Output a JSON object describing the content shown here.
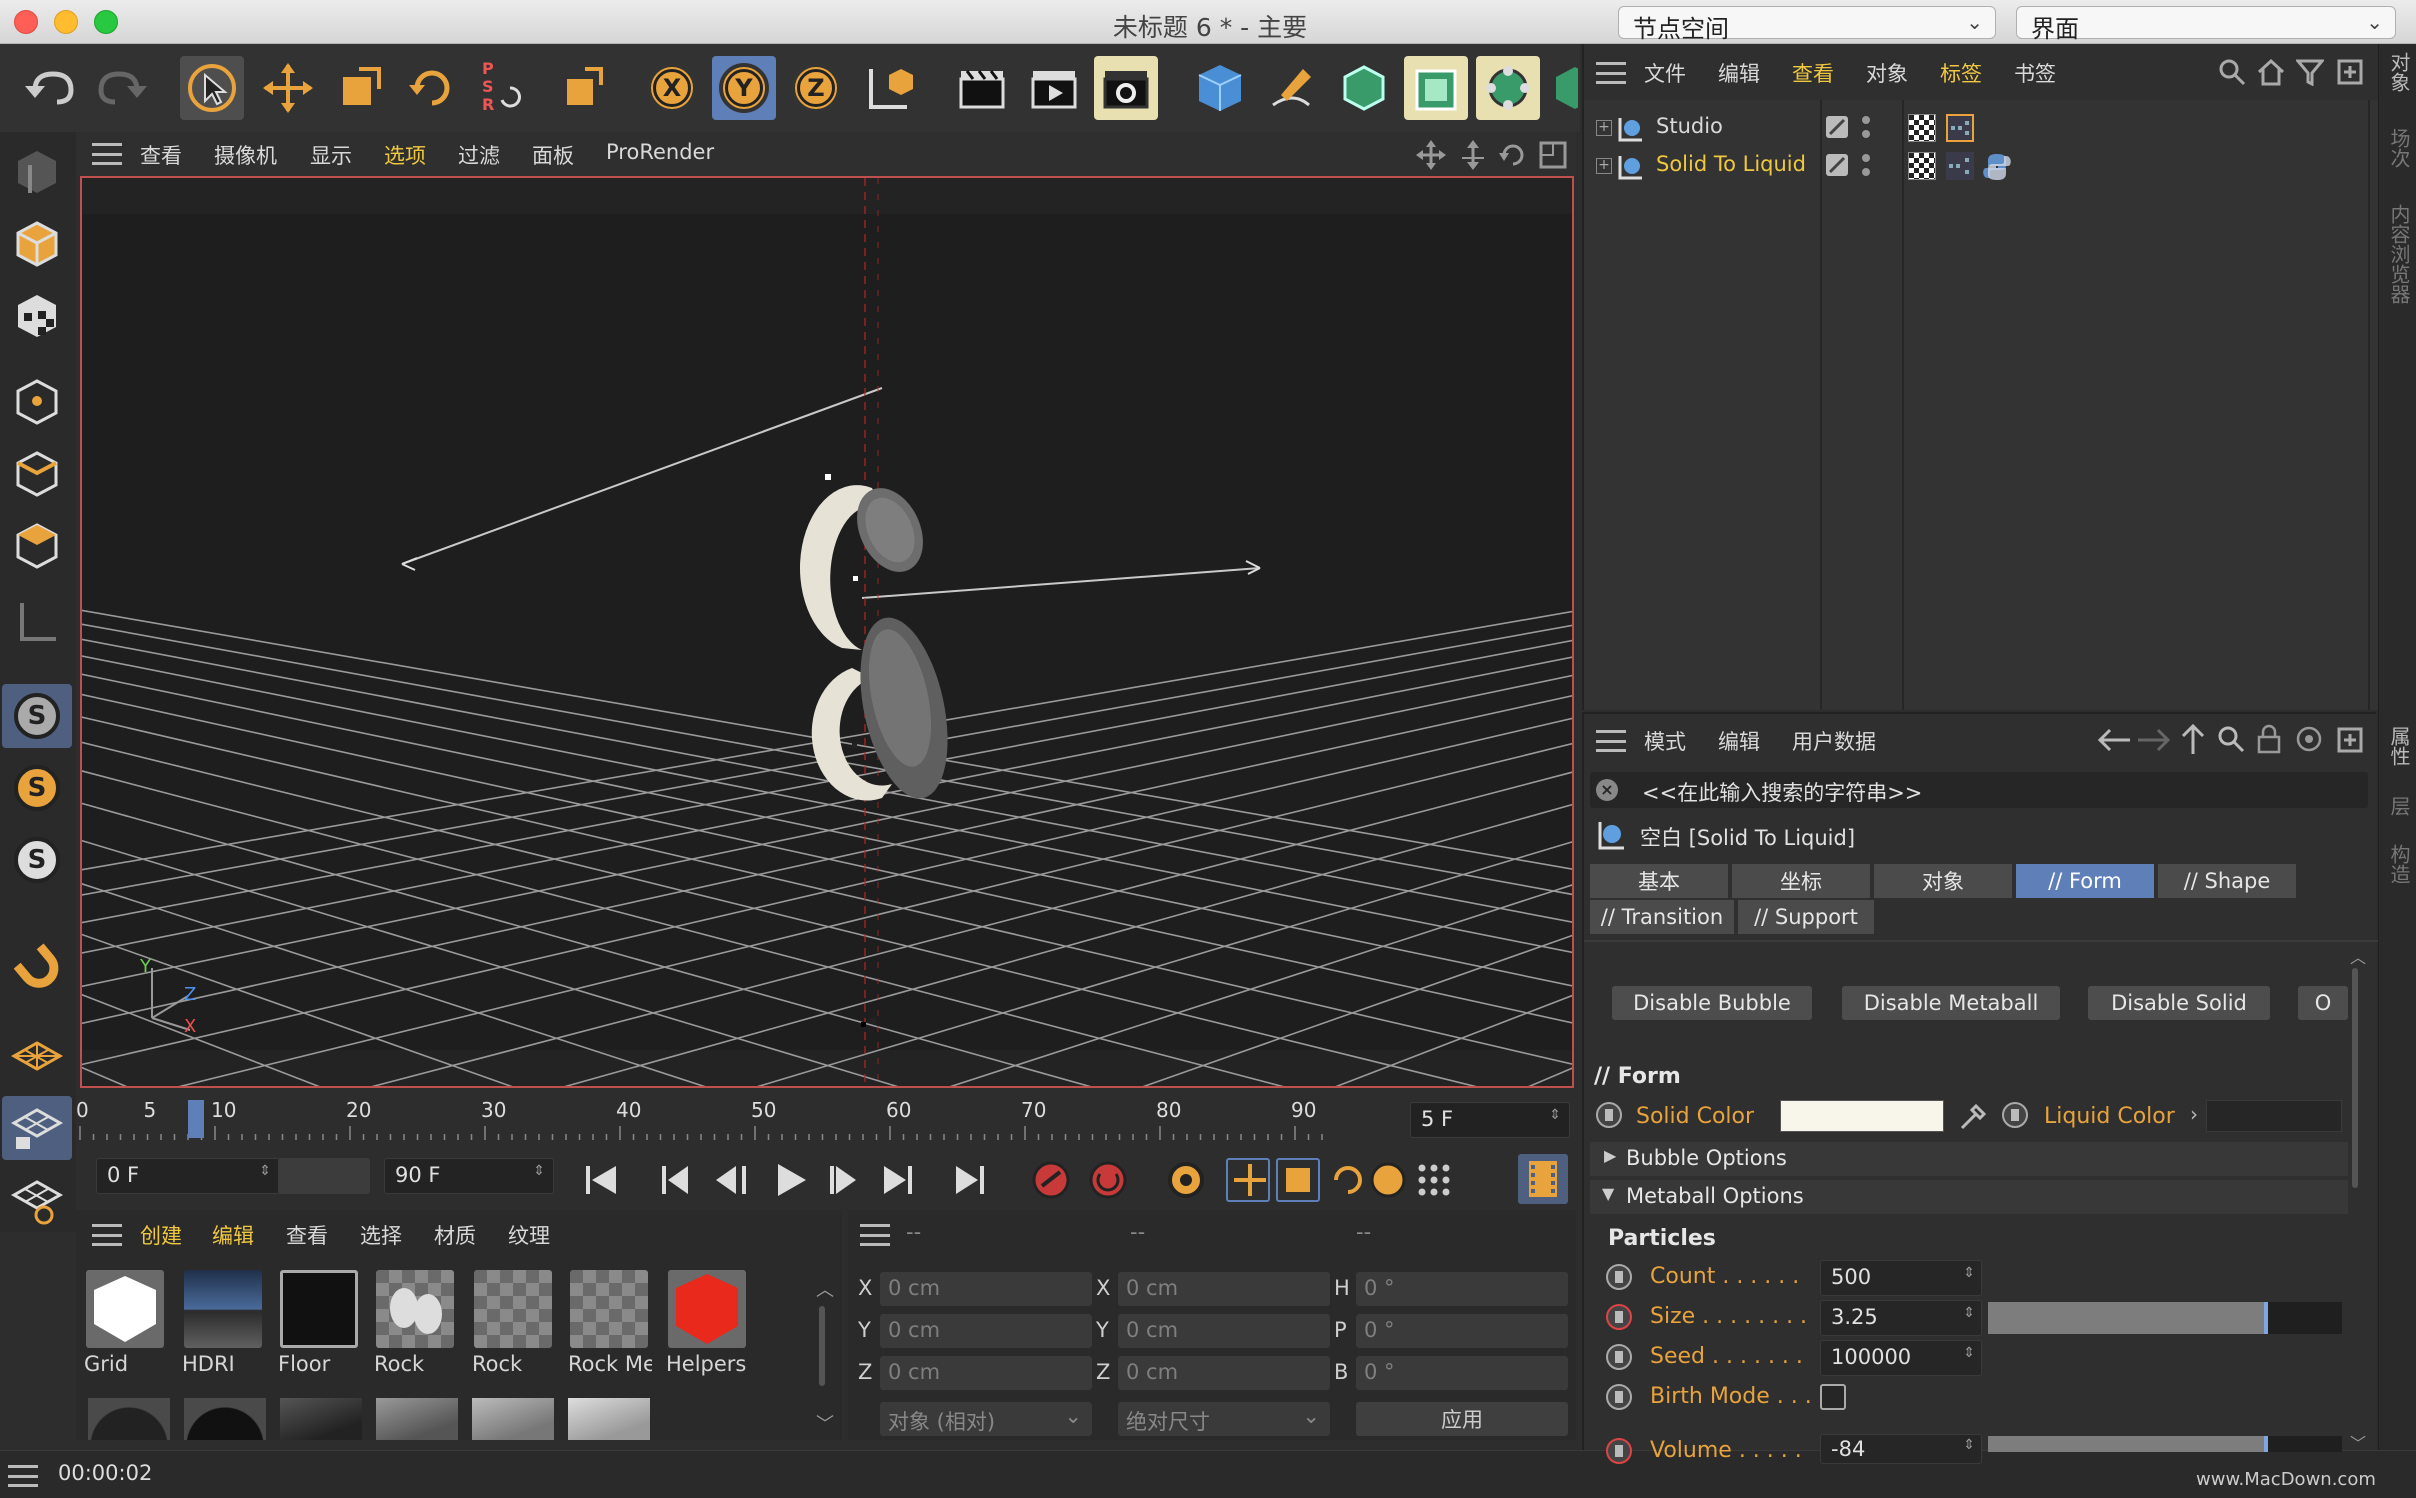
{
  "window": {
    "title": "未标题 6 * - 主要",
    "node_space": "节点空间",
    "layout": "界面"
  },
  "viewport_menu": {
    "items": [
      "查看",
      "摄像机",
      "显示",
      "选项",
      "过滤",
      "面板",
      "ProRender"
    ],
    "highlight_index": 3
  },
  "toolbar": {
    "psr_label": "P S R",
    "axis_x": "X",
    "axis_y": "Y",
    "axis_z": "Z"
  },
  "viewport_axis": {
    "y": "Y",
    "z": "Z",
    "x": "X"
  },
  "object_manager": {
    "menu": [
      "文件",
      "编辑",
      "查看",
      "对象",
      "标签",
      "书签"
    ],
    "objects": [
      {
        "name": "Studio",
        "selected": false
      },
      {
        "name": "Solid To Liquid",
        "selected": true
      }
    ]
  },
  "right_vtabs": {
    "top": [
      "对象",
      "场次",
      "内容浏览器"
    ],
    "bottom": [
      "属性",
      "层",
      "构造"
    ]
  },
  "attributes": {
    "menu": [
      "模式",
      "编辑",
      "用户数据"
    ],
    "search_placeholder": "<<在此输入搜索的字符串>>",
    "object_title": "空白 [Solid To Liquid]",
    "tabs_row1": [
      "基本",
      "坐标",
      "对象",
      "// Form",
      "// Shape"
    ],
    "tabs_row2": [
      "// Transition",
      "// Support"
    ],
    "active_tab": "// Form",
    "buttons": [
      "Disable Bubble",
      "Disable Metaball",
      "Disable Solid",
      "O"
    ],
    "section_title": "// Form",
    "solid_color_label": "Solid Color",
    "liquid_color_label": "Liquid Color",
    "solid_color": "#f8f6ea",
    "bubble_options": "Bubble Options",
    "metaball_options": "Metaball Options",
    "particles_heading": "Particles",
    "count_label": "Count . . . . . .",
    "count_value": "500",
    "size_label": "Size . . . . . . . .",
    "size_value": "3.25",
    "size_slider": 0.79,
    "seed_label": "Seed . . . . . . .",
    "seed_value": "100000",
    "birth_label": "Birth Mode . . .",
    "volume_label": "Volume . . . . .",
    "volume_value": "-84",
    "volume_slider": 0.79
  },
  "timeline": {
    "ticks": [
      "0",
      "5",
      "10",
      "20",
      "30",
      "40",
      "50",
      "60",
      "70",
      "80",
      "90"
    ],
    "current_frame": "5 F",
    "start_field": "0 F",
    "end_field": "90 F"
  },
  "materials": {
    "menu": [
      "创建",
      "编辑",
      "查看",
      "选择",
      "材质",
      "纹理"
    ],
    "items": [
      "Grid",
      "HDRI",
      "Floor",
      "Rock",
      "Rock",
      "Rock Me",
      "Helpers"
    ]
  },
  "coordinates": {
    "headers": [
      "--",
      "--",
      "--"
    ],
    "pos_labels": [
      "X",
      "Y",
      "Z"
    ],
    "pos_values": [
      "0 cm",
      "0 cm",
      "0 cm"
    ],
    "size_labels": [
      "X",
      "Y",
      "Z"
    ],
    "size_values": [
      "0 cm",
      "0 cm",
      "0 cm"
    ],
    "rot_labels": [
      "H",
      "P",
      "B"
    ],
    "rot_values": [
      "0 °",
      "0 °",
      "0 °"
    ],
    "mode": "对象 (相对)",
    "size_mode": "绝对尺寸",
    "apply": "应用"
  },
  "status": {
    "time": "00:00:02"
  },
  "watermark": "www.MacDown.com",
  "colors": {
    "accent_orange": "#e8a33c",
    "selected_yellow": "#f0c840",
    "tab_active": "#5f7fb8",
    "viewport_border": "#c0504d"
  }
}
